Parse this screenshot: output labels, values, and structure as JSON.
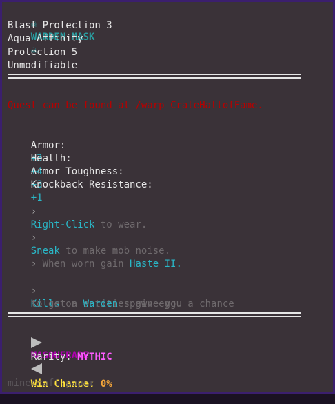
{
  "item": {
    "title": "WARDEN MASK",
    "skull_glyph": "☠",
    "enchantments": [
      "Blast Protection 3",
      "Aqua Affinity",
      "Protection 5",
      "Unmodifiable"
    ],
    "quest_note": "Quest can be found at /warp CrateHallofFame.",
    "stats": [
      {
        "label": "Armor:",
        "value": "+3"
      },
      {
        "label": "Health:",
        "value": "+4"
      },
      {
        "label": "Armor Toughness:",
        "value": "+3"
      },
      {
        "label": "Knockback Resistance:",
        "value": "+1"
      }
    ],
    "abilities": {
      "a1_prefix": "›",
      "a1_key": "Right-Click",
      "a1_text": " to wear.",
      "a2_prefix": "›",
      "a2_key": "Sneak",
      "a2_text": " to make mob noise.",
      "a3_prefix": "›",
      "a3_text": " When worn gain ",
      "a3_key": "Haste II.",
      "a4_prefix": "›",
      "a4_key": "Kills",
      "a4_text": " on entities give you a chance",
      "a4_line2_pre": "to get a ",
      "a4_line2_key": "Warden",
      "a4_line2_post": " spawn egg."
    },
    "crate": "MASQUERADE",
    "rarity_label": "Rarity: ",
    "rarity_value": "MYTHIC",
    "win_label": "Win Chance: ",
    "win_value": "0%",
    "item_id": "minecraft:paper"
  }
}
